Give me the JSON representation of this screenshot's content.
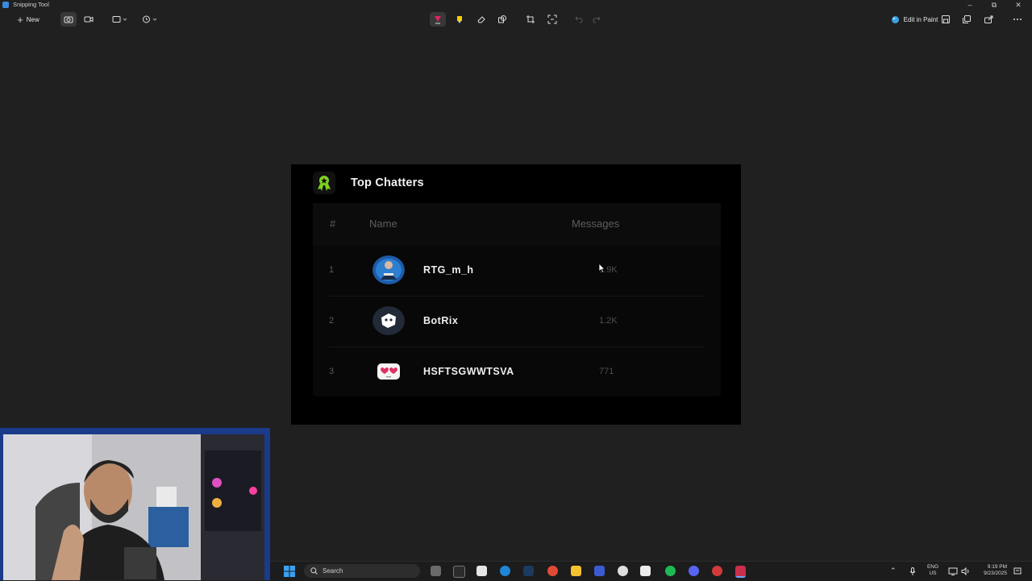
{
  "window": {
    "title": "Snipping Tool"
  },
  "toolbar": {
    "new_label": "New",
    "edit_in_paint_label": "Edit in Paint"
  },
  "widget": {
    "title": "Top Chatters",
    "columns": {
      "rank": "#",
      "name": "Name",
      "messages": "Messages"
    },
    "rows": [
      {
        "rank": "1",
        "name": "RTG_m_h",
        "messages": "1.9K"
      },
      {
        "rank": "2",
        "name": "BotRix",
        "messages": "1.2K"
      },
      {
        "rank": "3",
        "name": "HSFTSGWWTSVA",
        "messages": "771"
      }
    ]
  },
  "taskbar": {
    "search_placeholder": "Search",
    "lang_top": "ENG",
    "lang_bottom": "US",
    "time": "9:19 PM",
    "date": "9/23/2025"
  },
  "colors": {
    "accent_green": "#7ed321",
    "background": "#202020",
    "capture_bg": "#000000"
  }
}
